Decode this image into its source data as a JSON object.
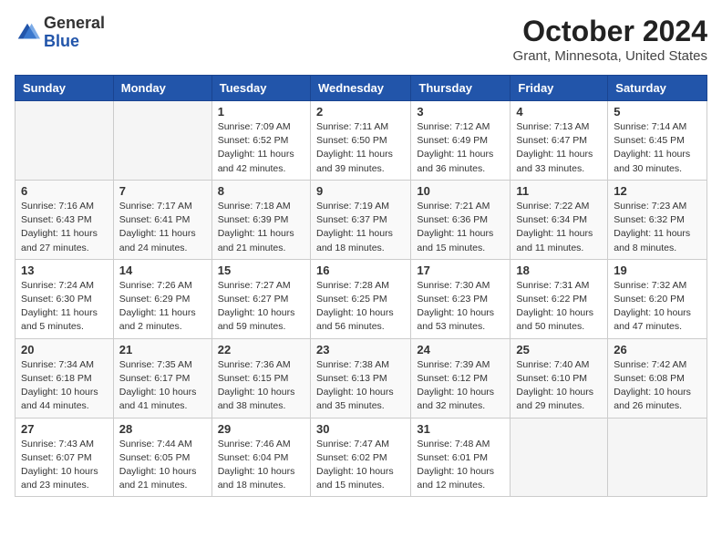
{
  "header": {
    "logo_general": "General",
    "logo_blue": "Blue",
    "month_title": "October 2024",
    "location": "Grant, Minnesota, United States"
  },
  "weekdays": [
    "Sunday",
    "Monday",
    "Tuesday",
    "Wednesday",
    "Thursday",
    "Friday",
    "Saturday"
  ],
  "weeks": [
    [
      {
        "day": "",
        "info": ""
      },
      {
        "day": "",
        "info": ""
      },
      {
        "day": "1",
        "info": "Sunrise: 7:09 AM\nSunset: 6:52 PM\nDaylight: 11 hours and 42 minutes."
      },
      {
        "day": "2",
        "info": "Sunrise: 7:11 AM\nSunset: 6:50 PM\nDaylight: 11 hours and 39 minutes."
      },
      {
        "day": "3",
        "info": "Sunrise: 7:12 AM\nSunset: 6:49 PM\nDaylight: 11 hours and 36 minutes."
      },
      {
        "day": "4",
        "info": "Sunrise: 7:13 AM\nSunset: 6:47 PM\nDaylight: 11 hours and 33 minutes."
      },
      {
        "day": "5",
        "info": "Sunrise: 7:14 AM\nSunset: 6:45 PM\nDaylight: 11 hours and 30 minutes."
      }
    ],
    [
      {
        "day": "6",
        "info": "Sunrise: 7:16 AM\nSunset: 6:43 PM\nDaylight: 11 hours and 27 minutes."
      },
      {
        "day": "7",
        "info": "Sunrise: 7:17 AM\nSunset: 6:41 PM\nDaylight: 11 hours and 24 minutes."
      },
      {
        "day": "8",
        "info": "Sunrise: 7:18 AM\nSunset: 6:39 PM\nDaylight: 11 hours and 21 minutes."
      },
      {
        "day": "9",
        "info": "Sunrise: 7:19 AM\nSunset: 6:37 PM\nDaylight: 11 hours and 18 minutes."
      },
      {
        "day": "10",
        "info": "Sunrise: 7:21 AM\nSunset: 6:36 PM\nDaylight: 11 hours and 15 minutes."
      },
      {
        "day": "11",
        "info": "Sunrise: 7:22 AM\nSunset: 6:34 PM\nDaylight: 11 hours and 11 minutes."
      },
      {
        "day": "12",
        "info": "Sunrise: 7:23 AM\nSunset: 6:32 PM\nDaylight: 11 hours and 8 minutes."
      }
    ],
    [
      {
        "day": "13",
        "info": "Sunrise: 7:24 AM\nSunset: 6:30 PM\nDaylight: 11 hours and 5 minutes."
      },
      {
        "day": "14",
        "info": "Sunrise: 7:26 AM\nSunset: 6:29 PM\nDaylight: 11 hours and 2 minutes."
      },
      {
        "day": "15",
        "info": "Sunrise: 7:27 AM\nSunset: 6:27 PM\nDaylight: 10 hours and 59 minutes."
      },
      {
        "day": "16",
        "info": "Sunrise: 7:28 AM\nSunset: 6:25 PM\nDaylight: 10 hours and 56 minutes."
      },
      {
        "day": "17",
        "info": "Sunrise: 7:30 AM\nSunset: 6:23 PM\nDaylight: 10 hours and 53 minutes."
      },
      {
        "day": "18",
        "info": "Sunrise: 7:31 AM\nSunset: 6:22 PM\nDaylight: 10 hours and 50 minutes."
      },
      {
        "day": "19",
        "info": "Sunrise: 7:32 AM\nSunset: 6:20 PM\nDaylight: 10 hours and 47 minutes."
      }
    ],
    [
      {
        "day": "20",
        "info": "Sunrise: 7:34 AM\nSunset: 6:18 PM\nDaylight: 10 hours and 44 minutes."
      },
      {
        "day": "21",
        "info": "Sunrise: 7:35 AM\nSunset: 6:17 PM\nDaylight: 10 hours and 41 minutes."
      },
      {
        "day": "22",
        "info": "Sunrise: 7:36 AM\nSunset: 6:15 PM\nDaylight: 10 hours and 38 minutes."
      },
      {
        "day": "23",
        "info": "Sunrise: 7:38 AM\nSunset: 6:13 PM\nDaylight: 10 hours and 35 minutes."
      },
      {
        "day": "24",
        "info": "Sunrise: 7:39 AM\nSunset: 6:12 PM\nDaylight: 10 hours and 32 minutes."
      },
      {
        "day": "25",
        "info": "Sunrise: 7:40 AM\nSunset: 6:10 PM\nDaylight: 10 hours and 29 minutes."
      },
      {
        "day": "26",
        "info": "Sunrise: 7:42 AM\nSunset: 6:08 PM\nDaylight: 10 hours and 26 minutes."
      }
    ],
    [
      {
        "day": "27",
        "info": "Sunrise: 7:43 AM\nSunset: 6:07 PM\nDaylight: 10 hours and 23 minutes."
      },
      {
        "day": "28",
        "info": "Sunrise: 7:44 AM\nSunset: 6:05 PM\nDaylight: 10 hours and 21 minutes."
      },
      {
        "day": "29",
        "info": "Sunrise: 7:46 AM\nSunset: 6:04 PM\nDaylight: 10 hours and 18 minutes."
      },
      {
        "day": "30",
        "info": "Sunrise: 7:47 AM\nSunset: 6:02 PM\nDaylight: 10 hours and 15 minutes."
      },
      {
        "day": "31",
        "info": "Sunrise: 7:48 AM\nSunset: 6:01 PM\nDaylight: 10 hours and 12 minutes."
      },
      {
        "day": "",
        "info": ""
      },
      {
        "day": "",
        "info": ""
      }
    ]
  ]
}
